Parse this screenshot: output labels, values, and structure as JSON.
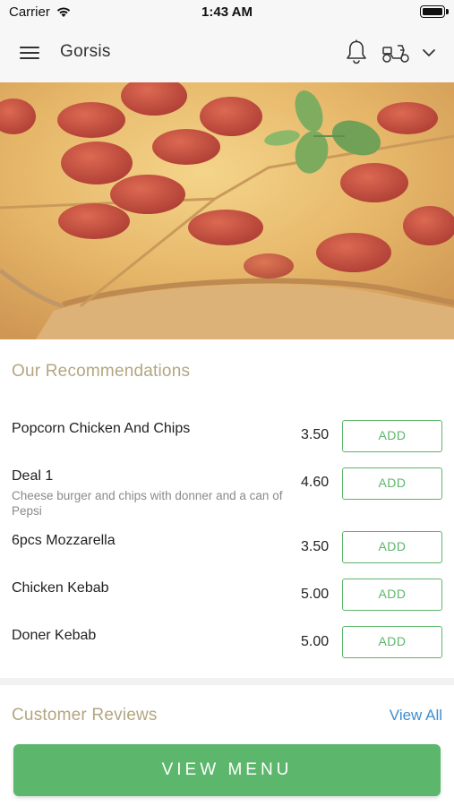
{
  "status_bar": {
    "carrier": "Carrier",
    "time": "1:43 AM"
  },
  "header": {
    "title": "Gorsis",
    "icons": [
      "hamburger-menu-icon",
      "bell-icon",
      "scooter-icon",
      "chevron-down-icon"
    ]
  },
  "hero": {
    "image": "pepperoni-pizza-with-basil"
  },
  "recommendations": {
    "heading": "Our Recommendations",
    "items": [
      {
        "name": "Popcorn Chicken And Chips",
        "description": "",
        "price": "3.50",
        "button": "ADD"
      },
      {
        "name": "Deal 1",
        "description": "Cheese burger and chips with donner and a can of Pepsi",
        "price": "4.60",
        "button": "ADD"
      },
      {
        "name": "6pcs Mozzarella",
        "description": "",
        "price": "3.50",
        "button": "ADD"
      },
      {
        "name": "Chicken Kebab",
        "description": "",
        "price": "5.00",
        "button": "ADD"
      },
      {
        "name": "Doner Kebab",
        "description": "",
        "price": "5.00",
        "button": "ADD"
      }
    ]
  },
  "reviews": {
    "heading": "Customer Reviews",
    "view_all": "View All"
  },
  "footer": {
    "view_menu": "VIEW MENU"
  },
  "colors": {
    "accent_green": "#5cb66b",
    "heading_tan": "#b3a681",
    "link_blue": "#3d8fd0"
  }
}
